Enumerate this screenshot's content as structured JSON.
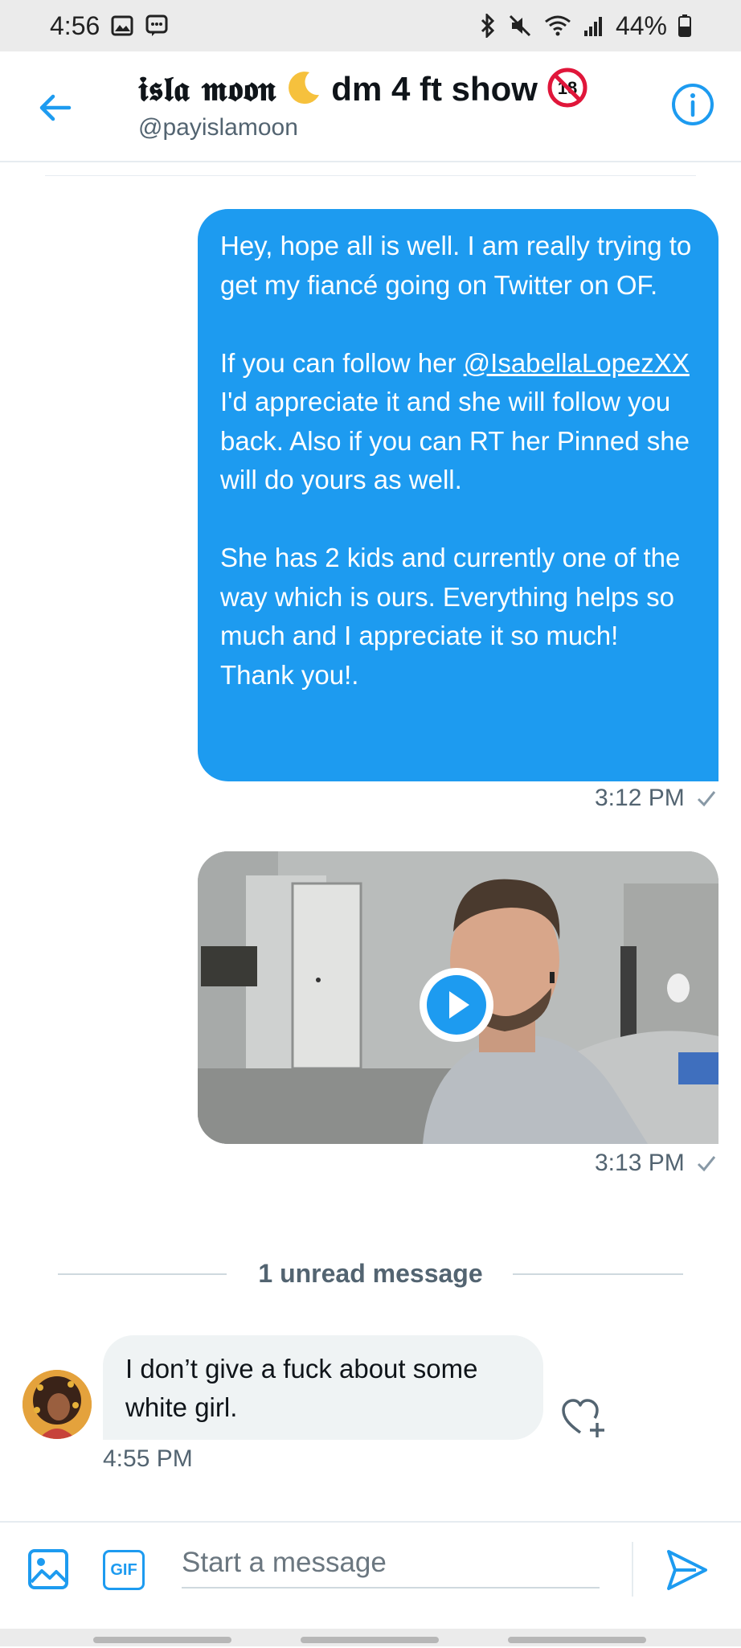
{
  "status_bar": {
    "time": "4:56",
    "battery": "44%"
  },
  "header": {
    "title_fancy": "𝖎𝖘𝖑𝖆 𝖒𝖔𝖔𝖓",
    "title_rest": "dm 4 ft show",
    "handle": "@payislamoon",
    "badge_text": "18"
  },
  "messages": {
    "outgoing": {
      "para1": "Hey, hope all is well. I am really trying to get my fiancé going on Twitter on OF.",
      "para2_before": "If you can follow her ",
      "para2_mention": "@IsabellaLopezXX",
      "para2_after": " I'd appreciate it and she will follow you back. Also if you can RT her Pinned she will do yours as well.",
      "para3": "She has 2 kids and currently one of the way which is ours. Everything helps so much and I appreciate it so much! Thank you!.",
      "time": "3:12 PM"
    },
    "video": {
      "time": "3:13 PM"
    },
    "unread_label": "1 unread message",
    "incoming": {
      "text": "I don’t give a fuck about some white girl.",
      "time": "4:55 PM"
    }
  },
  "composer": {
    "placeholder": "Start a message",
    "gif_label": "GIF"
  },
  "colors": {
    "accent": "#1d9bf0",
    "incoming_bubble": "#eff3f4",
    "secondary_text": "#536471"
  }
}
